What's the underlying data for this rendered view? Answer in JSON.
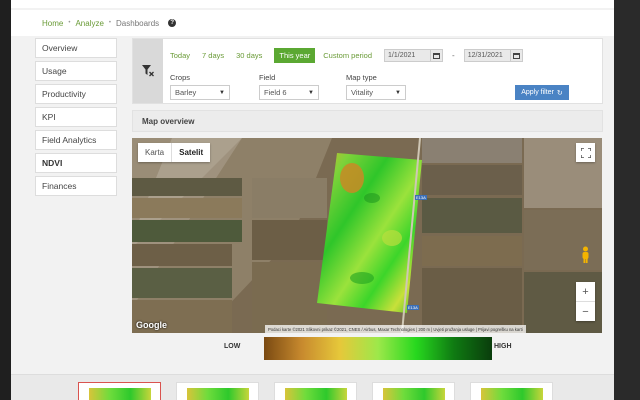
{
  "breadcrumb": {
    "home": "Home",
    "analyze": "Analyze",
    "dashboards": "Dashboards"
  },
  "sidebar": {
    "items": [
      {
        "label": "Overview"
      },
      {
        "label": "Usage"
      },
      {
        "label": "Productivity"
      },
      {
        "label": "KPI"
      },
      {
        "label": "Field Analytics"
      },
      {
        "label": "NDVI",
        "active": true
      },
      {
        "label": "Finances"
      }
    ]
  },
  "filters": {
    "periods": [
      "Today",
      "7 days",
      "30 days",
      "This year",
      "Custom period"
    ],
    "active_period": "This year",
    "date_from": "1/1/2021",
    "date_to": "12/31/2021",
    "crops_label": "Crops",
    "crops_value": "Barley",
    "field_label": "Field",
    "field_value": "Field 6",
    "maptype_label": "Map type",
    "maptype_value": "Vitality",
    "apply_label": "Apply filter"
  },
  "map": {
    "header": "Map overview",
    "toggle_map": "Karta",
    "toggle_satellite": "Satelit",
    "google": "Google",
    "attribution": "Podaci karte ©2021  Slikovni prikaz ©2021, CNES / Airbus, Maxar Technologies  |  200 m  |  Uvjeti pružanja usluge  |  Prijavi pogrešku na karti",
    "road_1": "E13A",
    "road_2": "E13A"
  },
  "legend": {
    "low": "LOW",
    "high": "HIGH"
  },
  "colors": {
    "accent_green": "#5ba832",
    "link_green": "#6a9b37",
    "button_blue": "#4a83c4"
  }
}
